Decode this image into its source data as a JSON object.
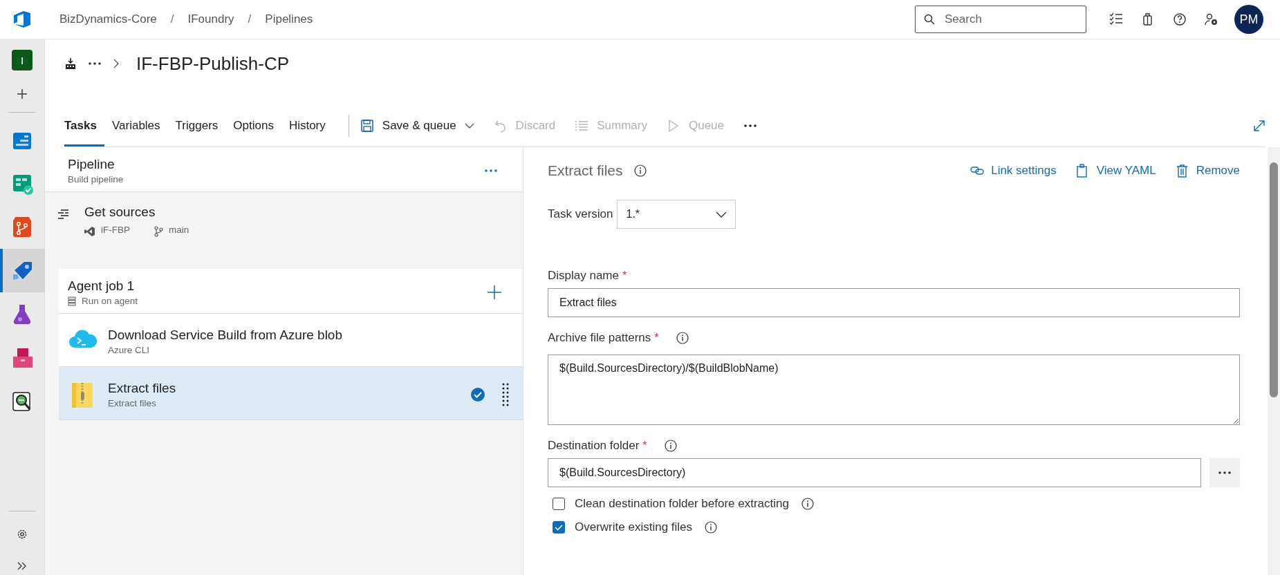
{
  "breadcrumbs": [
    {
      "label": "BizDynamics-Core",
      "separator": "/"
    },
    {
      "label": "IFoundry",
      "separator": "/"
    },
    {
      "label": "Pipelines"
    }
  ],
  "search": {
    "placeholder": "Search"
  },
  "header_icons": [
    {
      "kind": "tasks"
    },
    {
      "kind": "bag"
    },
    {
      "kind": "help"
    },
    {
      "kind": "user-settings"
    }
  ],
  "avatar": {
    "initials": "PM"
  },
  "rail": {
    "project_initial": "I",
    "items": [
      {
        "kind": "overview",
        "selected": false
      },
      {
        "kind": "boards",
        "selected": false
      },
      {
        "kind": "repos",
        "selected": false
      },
      {
        "kind": "pipelines",
        "selected": true
      },
      {
        "kind": "test",
        "selected": false
      },
      {
        "kind": "artifacts",
        "selected": false
      },
      {
        "kind": "search-ext",
        "selected": false
      }
    ]
  },
  "page_title": "IF-FBP-Publish-CP",
  "tabs": [
    {
      "label": "Tasks",
      "selected": true
    },
    {
      "label": "Variables",
      "selected": false
    },
    {
      "label": "Triggers",
      "selected": false
    },
    {
      "label": "Options",
      "selected": false
    },
    {
      "label": "History",
      "selected": false
    }
  ],
  "toolbar": [
    {
      "kind": "save",
      "label": "Save & queue",
      "disabled": false
    },
    {
      "kind": "discard",
      "label": "Discard",
      "disabled": true
    },
    {
      "kind": "summary",
      "label": "Summary",
      "disabled": true
    },
    {
      "kind": "queue",
      "label": "Queue",
      "disabled": true
    }
  ],
  "left_panel": {
    "pipeline": {
      "title": "Pipeline",
      "subtitle": "Build pipeline"
    },
    "get_sources": {
      "title": "Get sources",
      "repo": "iF-FBP",
      "branch": "main"
    },
    "job": {
      "title": "Agent job 1",
      "subtitle": "Run on agent"
    },
    "tasks": [
      {
        "kind": "azure-cli",
        "title": "Download Service Build from Azure blob",
        "subtitle": "Azure CLI",
        "selected": false
      },
      {
        "kind": "extract",
        "title": "Extract files",
        "subtitle": "Extract files",
        "selected": true
      }
    ]
  },
  "details": {
    "title": "Extract files",
    "actions": [
      {
        "kind": "link",
        "label": "Link settings"
      },
      {
        "kind": "yaml",
        "label": "View YAML"
      },
      {
        "kind": "remove",
        "label": "Remove"
      }
    ],
    "task_version": {
      "label": "Task version",
      "value": "1.*"
    },
    "fields": [
      {
        "kind": "text",
        "label": "Display name",
        "required_mark": "*",
        "info": false,
        "value": "Extract files"
      },
      {
        "kind": "textarea",
        "label": "Archive file patterns",
        "required_mark": "*",
        "info": true,
        "value": "$(Build.SourcesDirectory)/$(BuildBlobName)"
      },
      {
        "kind": "browse",
        "label": "Destination folder",
        "required_mark": "*",
        "info": true,
        "value": "$(Build.SourcesDirectory)"
      }
    ],
    "checkboxes": [
      {
        "label": "Clean destination folder before extracting",
        "checked": false,
        "info": true
      },
      {
        "label": "Overwrite existing files",
        "checked": true,
        "info": true
      }
    ]
  }
}
